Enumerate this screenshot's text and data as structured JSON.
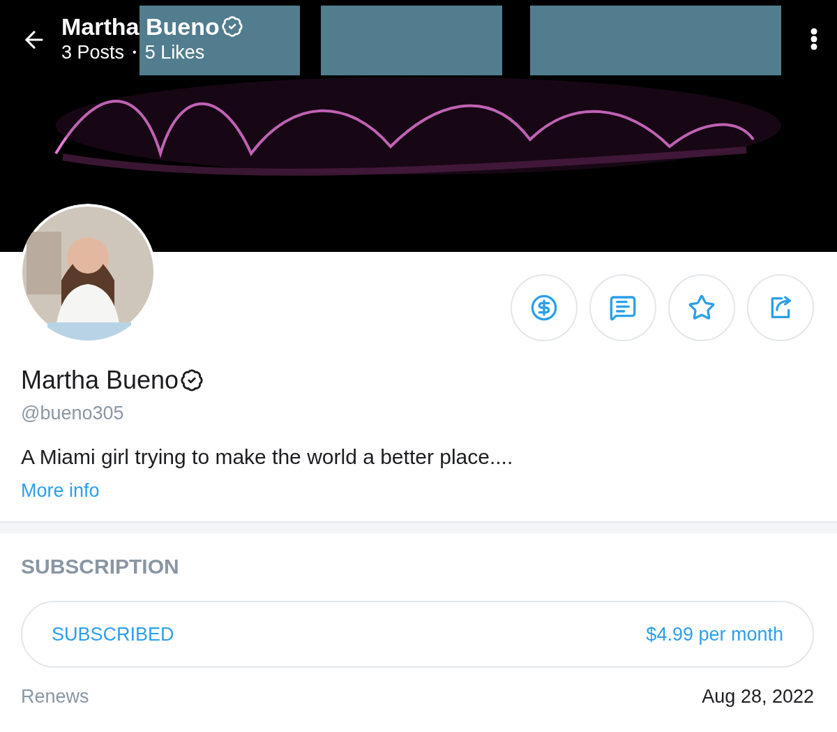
{
  "header": {
    "title": "Martha Bueno",
    "verified": true,
    "posts": "3 Posts",
    "separator": "•",
    "likes": "5 Likes"
  },
  "profile": {
    "name": "Martha Bueno",
    "verified": true,
    "handle": "@bueno305",
    "bio": "A Miami girl trying to make the world a better place....",
    "more_info": "More info"
  },
  "subscription": {
    "heading": "SUBSCRIPTION",
    "status": "SUBSCRIBED",
    "price": "$4.99 per month",
    "renew_label": "Renews",
    "renew_date": "Aug 28, 2022"
  }
}
